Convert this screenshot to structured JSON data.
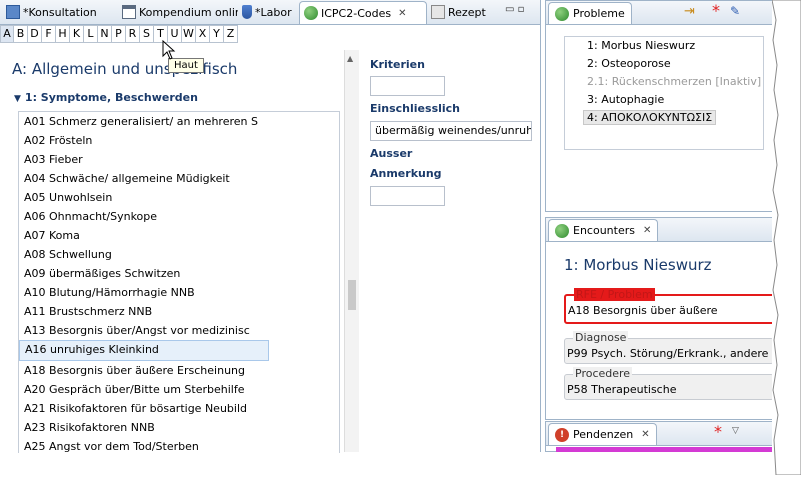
{
  "tabs": [
    {
      "label": "*Konsultation",
      "icon": "consultation-icon"
    },
    {
      "label": "Kompendium online",
      "icon": "browser-window-icon"
    },
    {
      "label": "*Labor",
      "icon": "flask-icon"
    },
    {
      "label": "ICPC2-Codes",
      "icon": "icpc-globe-icon",
      "active": true
    },
    {
      "label": "Rezept",
      "icon": "printer-icon"
    }
  ],
  "alphabet": [
    "A",
    "B",
    "D",
    "F",
    "H",
    "K",
    "L",
    "N",
    "P",
    "R",
    "S",
    "T",
    "U",
    "W",
    "X",
    "Y",
    "Z"
  ],
  "selected_letter": "A",
  "tooltip": "Haut",
  "code_title": "A: Allgemein und unspezifisch",
  "group_title": "1: Symptome, Beschwerden",
  "codes": [
    "A01 Schmerz generalisiert/ an mehreren S",
    "A02 Frösteln",
    "A03 Fieber",
    "A04 Schwäche/ allgemeine Müdigkeit",
    "A05 Unwohlsein",
    "A06 Ohnmacht/Synkope",
    "A07 Koma",
    "A08 Schwellung",
    "A09 übermäßiges Schwitzen",
    "A10 Blutung/Hämorrhagie NNB",
    "A11 Brustschmerz NNB",
    "A13 Besorgnis über/Angst vor medizinisc",
    "A16 unruhiges Kleinkind",
    "A18 Besorgnis über äußere Erscheinung",
    "A20 Gespräch über/Bitte um Sterbehilfe",
    "A21 Risikofaktoren für bösartige Neubild",
    "A23 Risikofaktoren NNB",
    "A25 Angst vor dem Tod/Sterben"
  ],
  "selected_code": "A16 unruhiges Kleinkind",
  "details": {
    "kriterien_label": "Kriterien",
    "kriterien_value": "",
    "einschliesslich_label": "Einschliesslich",
    "einschliesslich_value": "übermäßig weinendes/unruh",
    "ausser_label": "Ausser",
    "anmerkung_label": "Anmerkung",
    "anmerkung_value": ""
  },
  "probleme": {
    "title": "Probleme",
    "items": [
      {
        "label": "1: Morbus Nieswurz",
        "inactive": false
      },
      {
        "label": "2: Osteoporose",
        "inactive": false
      },
      {
        "label": "2.1: Rückenschmerzen [Inaktiv]",
        "inactive": true
      },
      {
        "label": "3: Autophagie",
        "inactive": false
      },
      {
        "label": "4: ΑΠΟΚΟΛΟΚΥΝΤΩΣΙΣ",
        "inactive": false,
        "selected": true
      }
    ]
  },
  "encounters": {
    "title": "Encounters",
    "heading": "1: Morbus Nieswurz",
    "rfe_label": "RFE / Problem",
    "rfe_value": "A18 Besorgnis über äußere",
    "diagnose_label": "Diagnose",
    "diagnose_value": "P99 Psych. Störung/Erkrank., andere",
    "procedere_label": "Procedere",
    "procedere_value": "P58 Therapeutische"
  },
  "pendenzen": {
    "title": "Pendenzen"
  },
  "colors": {
    "accent": "#1a3a6a",
    "rfe_red": "#e41a1a",
    "dirty_star": "#e02020"
  }
}
